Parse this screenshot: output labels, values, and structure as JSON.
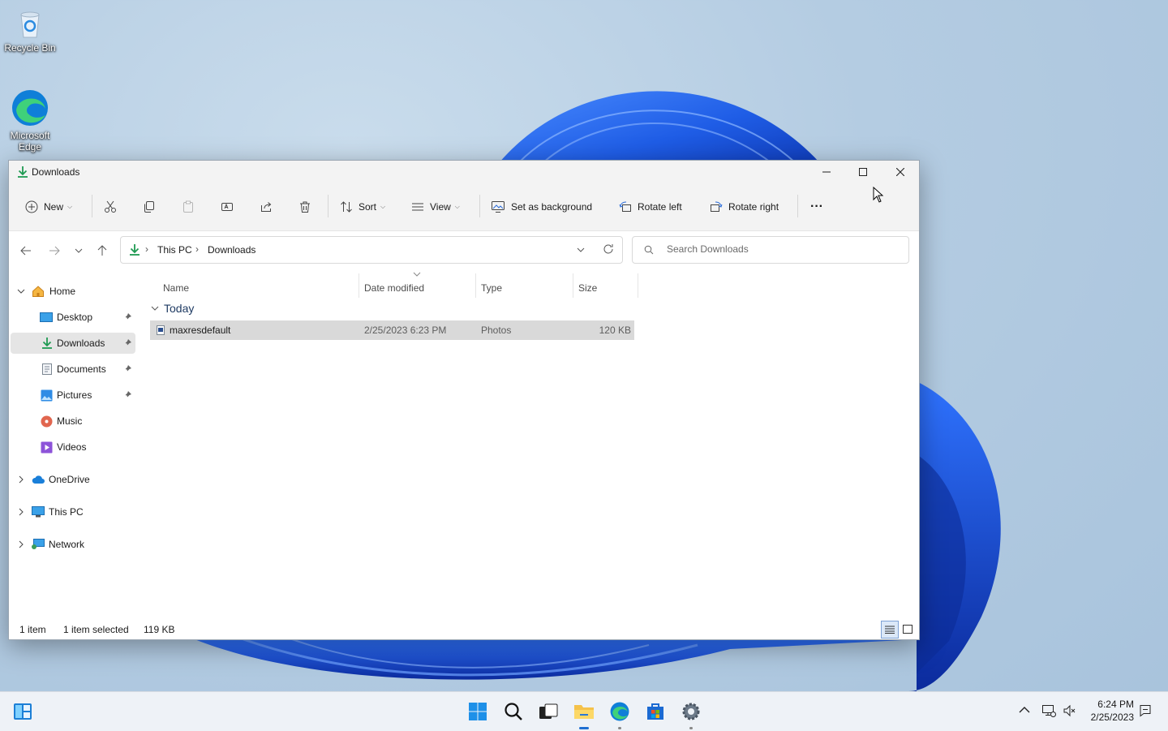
{
  "desktop": {
    "icons": [
      {
        "label": "Recycle Bin"
      },
      {
        "label": "Microsoft Edge"
      }
    ]
  },
  "window": {
    "title": "Downloads",
    "toolbar": {
      "new_label": "New",
      "sort_label": "Sort",
      "view_label": "View",
      "set_bg_label": "Set as background",
      "rotate_left_label": "Rotate left",
      "rotate_right_label": "Rotate right",
      "more_label": "···"
    },
    "address": {
      "crumbs": [
        "This PC",
        "Downloads"
      ],
      "search_placeholder": "Search Downloads"
    },
    "nav": {
      "home": "Home",
      "quick": [
        {
          "label": "Desktop",
          "pinned": true
        },
        {
          "label": "Downloads",
          "pinned": true,
          "selected": true
        },
        {
          "label": "Documents",
          "pinned": true
        },
        {
          "label": "Pictures",
          "pinned": true
        },
        {
          "label": "Music",
          "pinned": false
        },
        {
          "label": "Videos",
          "pinned": false
        }
      ],
      "onedrive": "OneDrive",
      "thispc": "This PC",
      "network": "Network"
    },
    "columns": {
      "name": "Name",
      "date": "Date modified",
      "type": "Type",
      "size": "Size"
    },
    "group_label": "Today",
    "files": [
      {
        "name": "maxresdefault",
        "date": "2/25/2023 6:23 PM",
        "type": "Photos",
        "size": "120 KB"
      }
    ],
    "status": {
      "count": "1 item",
      "selected": "1 item selected",
      "size": "119 KB"
    }
  },
  "taskbar": {
    "time": "6:24 PM",
    "date": "2/25/2023"
  }
}
